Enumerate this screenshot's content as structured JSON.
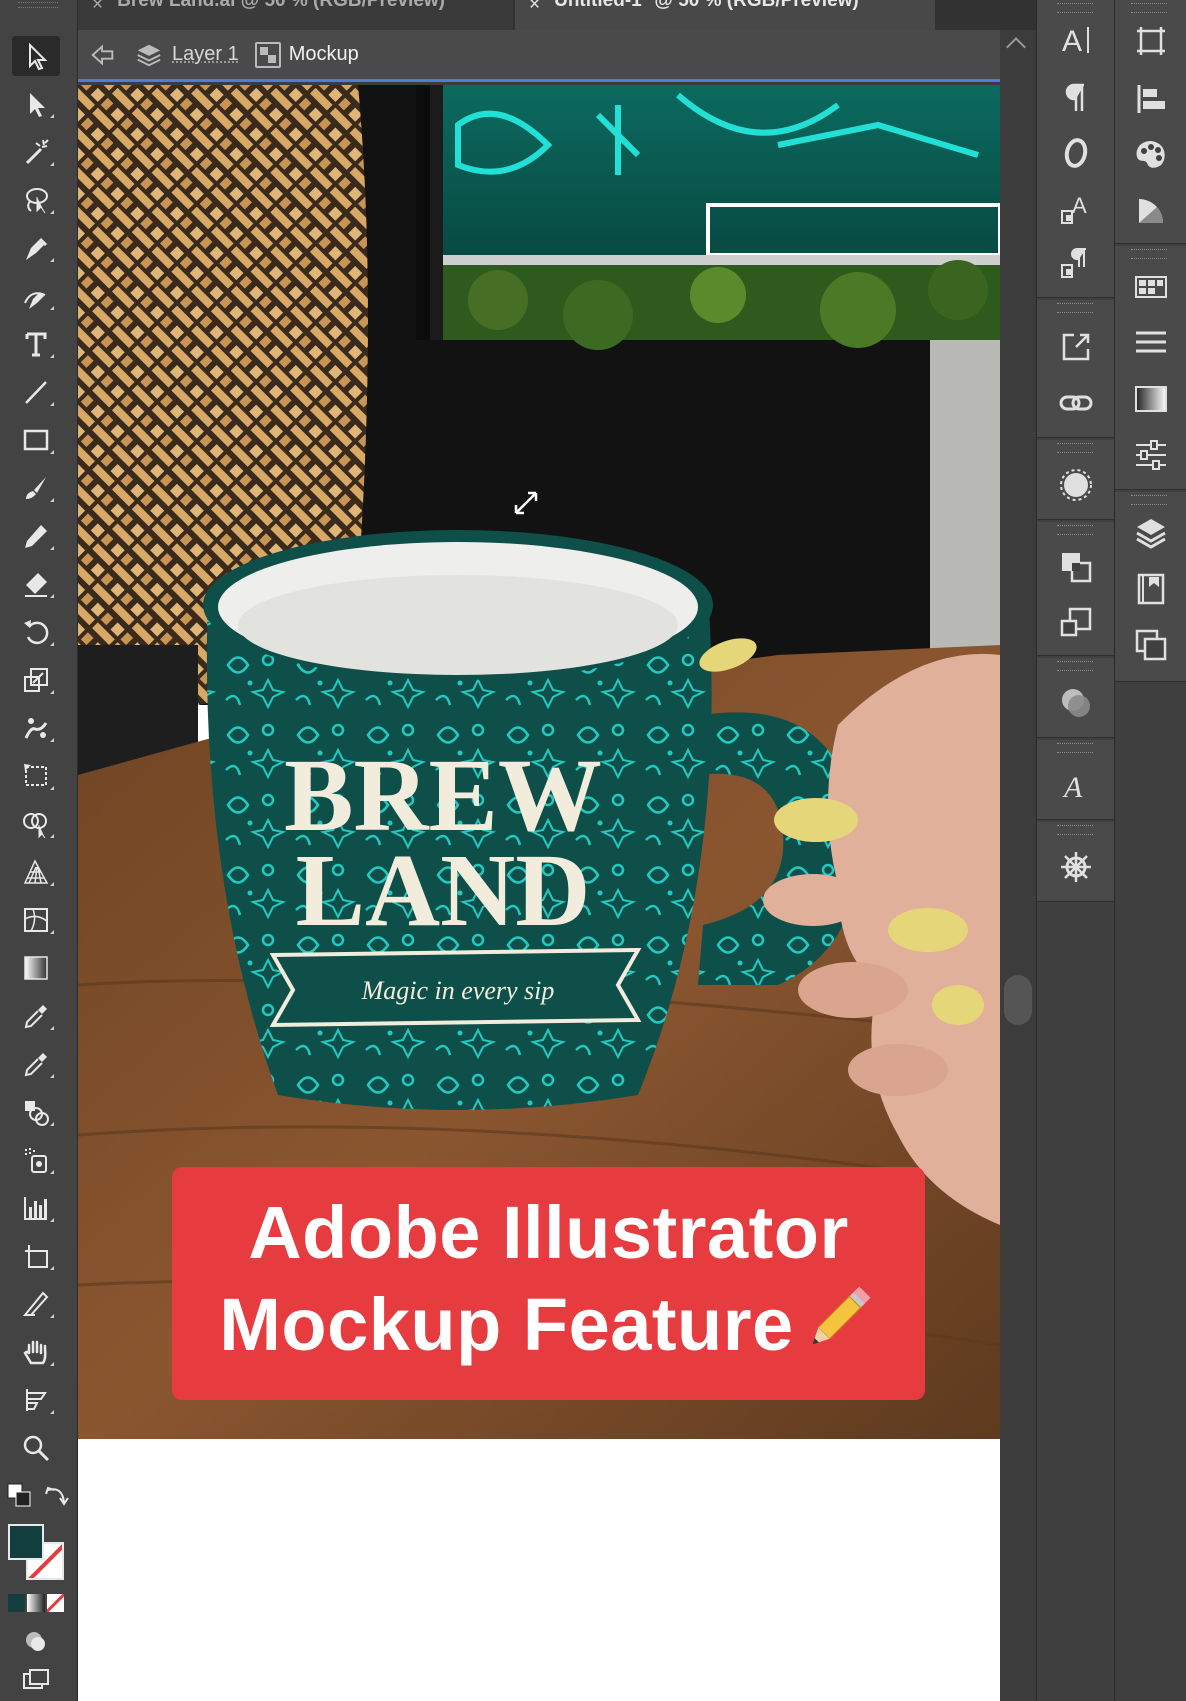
{
  "tabs": [
    {
      "close": "×",
      "label": "Brew Land.ai @ 50 % (RGB/Preview)"
    },
    {
      "close": "×",
      "label": "Untitled-1* @ 50 % (RGB/Preview)"
    }
  ],
  "breadcrumb": {
    "layer": "Layer 1",
    "object": "Mockup"
  },
  "mug_design": {
    "title_line1": "BREW",
    "title_line2": "LAND",
    "ribbon": "Magic in every sip"
  },
  "banner": {
    "line1": "Adobe Illustrator",
    "line2": "Mockup Feature"
  },
  "colors": {
    "banner_red": "#e63b3f",
    "mug_teal": "#0f4f4a",
    "pattern_cyan": "#22c9c0",
    "fill_swatch": "#123f3d",
    "selection_blue": "#4e7fd6"
  },
  "left_tools": [
    "selection-tool",
    "direct-selection-tool",
    "magic-wand-tool",
    "lasso-tool",
    "pen-tool",
    "curvature-tool",
    "type-tool",
    "line-segment-tool",
    "rectangle-tool",
    "paintbrush-tool",
    "pencil-tool",
    "eraser-tool",
    "rotate-tool",
    "scale-tool",
    "puppet-warp-tool",
    "free-transform-tool",
    "shape-builder-tool",
    "perspective-grid-tool",
    "mesh-tool",
    "gradient-tool",
    "eyedropper-tool",
    "measure-tool",
    "blend-tool",
    "symbol-sprayer-tool",
    "column-graph-tool",
    "artboard-tool",
    "slice-tool",
    "hand-tool",
    "print-tiling-tool",
    "zoom-tool"
  ],
  "right_panel_icons": [
    "character-panel",
    "paragraph-panel",
    "opentype-panel",
    "character-styles-panel",
    "paragraph-styles-panel",
    "export-panel",
    "links-panel",
    "appearance-panel",
    "pathfinder-panel",
    "transform-panel",
    "transparency-panel",
    "type-glyphs-panel",
    "properties-panel"
  ],
  "right_panel2_icons": [
    "artboards-panel",
    "align-panel",
    "color-panel",
    "color-guide-panel",
    "swatches-panel",
    "stroke-panel",
    "gradient-panel",
    "adjustments-panel",
    "layers-panel",
    "libraries-panel",
    "asset-export-panel"
  ]
}
